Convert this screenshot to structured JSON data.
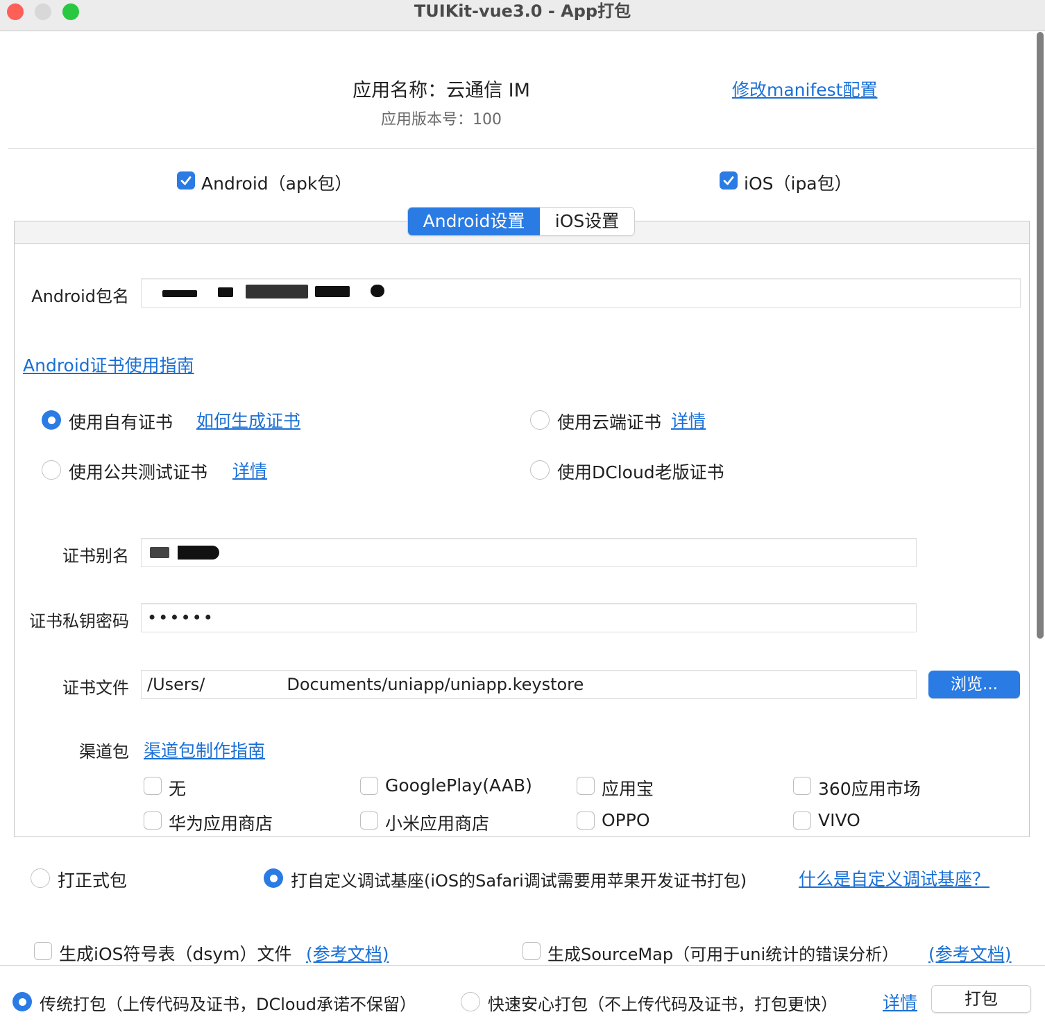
{
  "window": {
    "title": "TUIKit-vue3.0 - App打包",
    "traffic_lights": {
      "close": "#fe5f57",
      "minimize": "#d8d8d8",
      "maximize": "#28c840"
    }
  },
  "app_info": {
    "name_line": "应用名称：云通信 IM",
    "version_line": "应用版本号：100",
    "manifest_link": "修改manifest配置"
  },
  "platforms": {
    "android": {
      "label": "Android（apk包）",
      "checked": true
    },
    "ios": {
      "label": "iOS（ipa包）",
      "checked": true
    }
  },
  "tabs": [
    {
      "label": "Android设置",
      "active": true
    },
    {
      "label": "iOS设置",
      "active": false
    }
  ],
  "android": {
    "package_label": "Android包名",
    "package_value": "",
    "cert_guide_link": "Android证书使用指南",
    "cert_options": {
      "own": {
        "label": "使用自有证书",
        "link": "如何生成证书",
        "selected": true
      },
      "cloud": {
        "label": "使用云端证书",
        "link": "详情",
        "selected": false
      },
      "public_test": {
        "label": "使用公共测试证书",
        "link": "详情",
        "selected": false
      },
      "dcloud_old": {
        "label": "使用DCloud老版证书",
        "selected": false
      }
    },
    "alias_label": "证书别名",
    "alias_value": "",
    "password_label": "证书私钥密码",
    "password_value": "••••••",
    "file_label": "证书文件",
    "file_value_prefix": "/Users/",
    "file_value_suffix": "Documents/uniapp/uniapp.keystore",
    "browse_button": "浏览...",
    "channel_label": "渠道包",
    "channel_guide_link": "渠道包制作指南",
    "channels": [
      "无",
      "GooglePlay(AAB)",
      "应用宝",
      "360应用市场",
      "华为应用商店",
      "小米应用商店",
      "OPPO",
      "VIVO"
    ]
  },
  "build_type": {
    "release": {
      "label": "打正式包",
      "selected": false
    },
    "custom_debug": {
      "label": "打自定义调试基座(iOS的Safari调试需要用苹果开发证书打包)",
      "selected": true
    },
    "custom_debug_link": "什么是自定义调试基座？"
  },
  "extras": {
    "dsym": {
      "label": "生成iOS符号表（dsym）文件",
      "link": "(参考文档)",
      "checked": false
    },
    "sourcemap": {
      "label": "生成SourceMap（可用于uni统计的错误分析）",
      "link": "(参考文档)",
      "checked": false
    }
  },
  "footer": {
    "traditional": {
      "label": "传统打包（上传代码及证书，DCloud承诺不保留）",
      "selected": true
    },
    "fast": {
      "label": "快速安心打包（不上传代码及证书，打包更快）",
      "selected": false
    },
    "detail_link": "详情",
    "pack_button": "打包"
  },
  "colors": {
    "accent": "#2a7be4",
    "link": "#1a6fd6"
  }
}
